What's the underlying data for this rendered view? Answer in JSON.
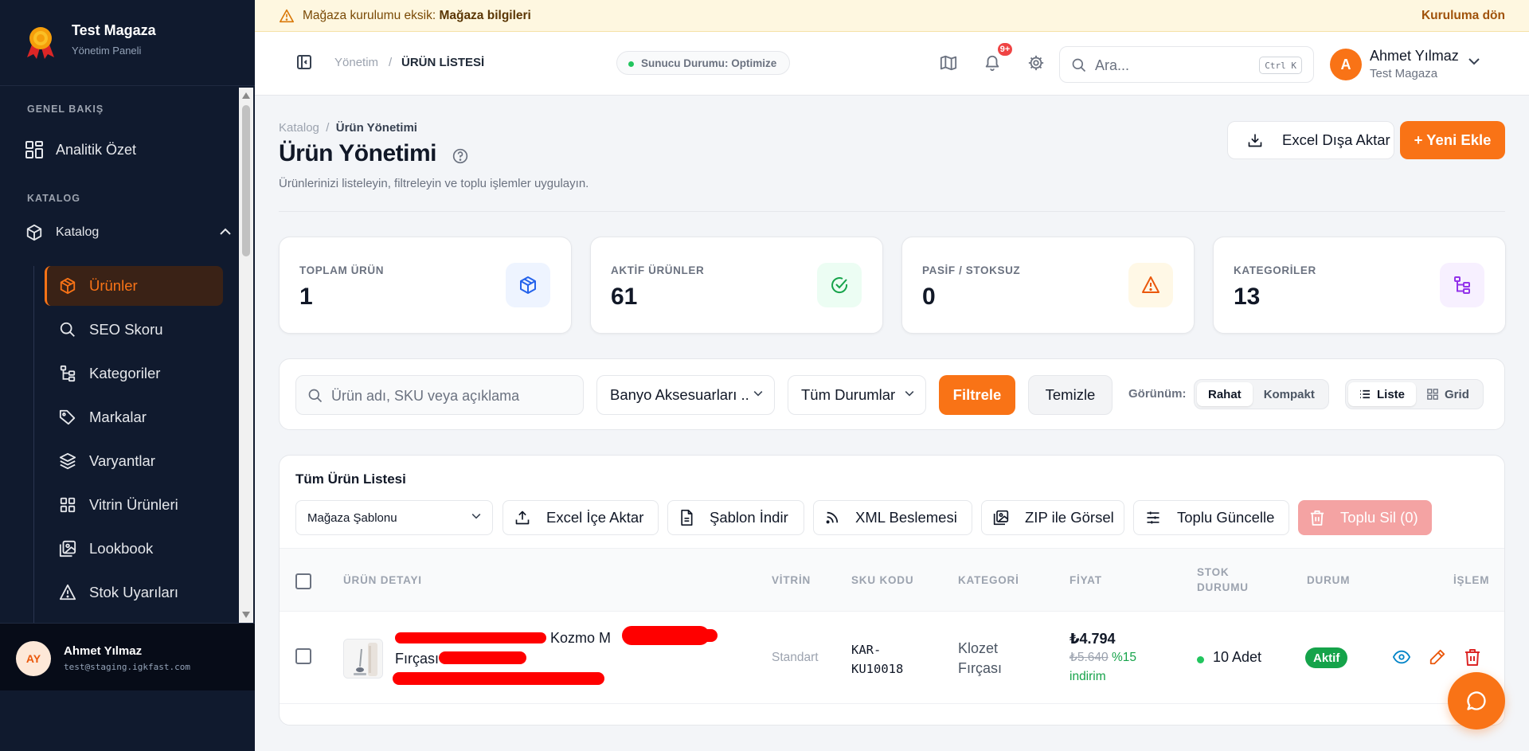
{
  "sidebar": {
    "brand_name": "Test Magaza",
    "brand_sub": "Yönetim Paneli",
    "section_overview": "GENEL BAKIŞ",
    "section_catalog": "KATALOG",
    "analytics": "Analitik Özet",
    "catalog": "Katalog",
    "items": [
      {
        "label": "Ürünler",
        "icon": "box-icon"
      },
      {
        "label": "SEO Skoru",
        "icon": "search-icon"
      },
      {
        "label": "Kategoriler",
        "icon": "category-tree-icon"
      },
      {
        "label": "Markalar",
        "icon": "tag-icon"
      },
      {
        "label": "Varyantlar",
        "icon": "layers-icon"
      },
      {
        "label": "Vitrin Ürünleri",
        "icon": "grid-icon"
      },
      {
        "label": "Lookbook",
        "icon": "image-gallery-icon"
      },
      {
        "label": "Stok Uyarıları",
        "icon": "warning-icon"
      }
    ],
    "user_initials": "AY",
    "user_name": "Ahmet Yılmaz",
    "user_email": "test@staging.igkfast.com"
  },
  "banner": {
    "text": "Mağaza kurulumu eksik: ",
    "bold": "Mağaza bilgileri",
    "link": "Kuruluma dön"
  },
  "topbar": {
    "crumb_root": "Yönetim",
    "crumb_sep": "/",
    "crumb_current": "ÜRÜN LİSTESİ",
    "server_status": "Sunucu Durumu: Optimize",
    "notif_count": "9+",
    "search_placeholder": "Ara...",
    "search_shortcut": "Ctrl K",
    "user_initial": "A",
    "user_name": "Ahmet Yılmaz",
    "user_store": "Test Magaza"
  },
  "page": {
    "crumb_root": "Katalog",
    "crumb_sep": "/",
    "crumb_current": "Ürün Yönetimi",
    "title": "Ürün Yönetimi",
    "subtitle": "Ürünlerinizi listeleyin, filtreleyin ve toplu işlemler uygulayın.",
    "export_label": "Excel Dışa Aktar",
    "add_label": "+ Yeni Ekle"
  },
  "stats": [
    {
      "label": "TOPLAM ÜRÜN",
      "value": "1",
      "color": "#2563eb"
    },
    {
      "label": "AKTİF ÜRÜNLER",
      "value": "61",
      "color": "#16a34a"
    },
    {
      "label": "PASİF / STOKSUZ",
      "value": "0",
      "color": "#f59e0b"
    },
    {
      "label": "KATEGORİLER",
      "value": "13",
      "color": "#9333ea"
    }
  ],
  "filters": {
    "search_placeholder": "Ürün adı, SKU veya açıklama",
    "category": "Banyo Aksesuarları ..",
    "status": "Tüm Durumlar",
    "filter_label": "Filtrele",
    "clear_label": "Temizle",
    "view_label": "Görünüm:",
    "density": [
      "Rahat",
      "Kompakt"
    ],
    "layout": [
      "Liste",
      "Grid"
    ]
  },
  "table": {
    "title": "Tüm Ürün Listesi",
    "template": "Mağaza Şablonu",
    "buttons": [
      "Excel İçe Aktar",
      "Şablon İndir",
      "XML Beslemesi",
      "ZIP ile Görsel",
      "Toplu Güncelle",
      "Toplu Sil (0)"
    ],
    "headers": [
      "ÜRÜN DETAYI",
      "VİTRİN",
      "SKU KODU",
      "KATEGORİ",
      "FİYAT",
      "STOK",
      "DURUMU",
      "DURUM",
      "İŞLEM"
    ],
    "rows": [
      {
        "name_l1": "Kozmo M",
        "name_l2": "Fırçası",
        "vitrin": "Standart",
        "sku_l1": "KAR-",
        "sku_l2": "KU10018",
        "category_l1": "Klozet",
        "category_l2": "Fırçası",
        "price": "₺4.794",
        "old_price": "₺5.640",
        "discount": "%15",
        "discount_word": "indirim",
        "stock": "10 Adet",
        "status": "Aktif"
      }
    ]
  },
  "colors": {
    "accent": "#f97316",
    "sidebar_bg": "#101a2e",
    "success": "#15a34a",
    "danger": "#dc2626"
  }
}
